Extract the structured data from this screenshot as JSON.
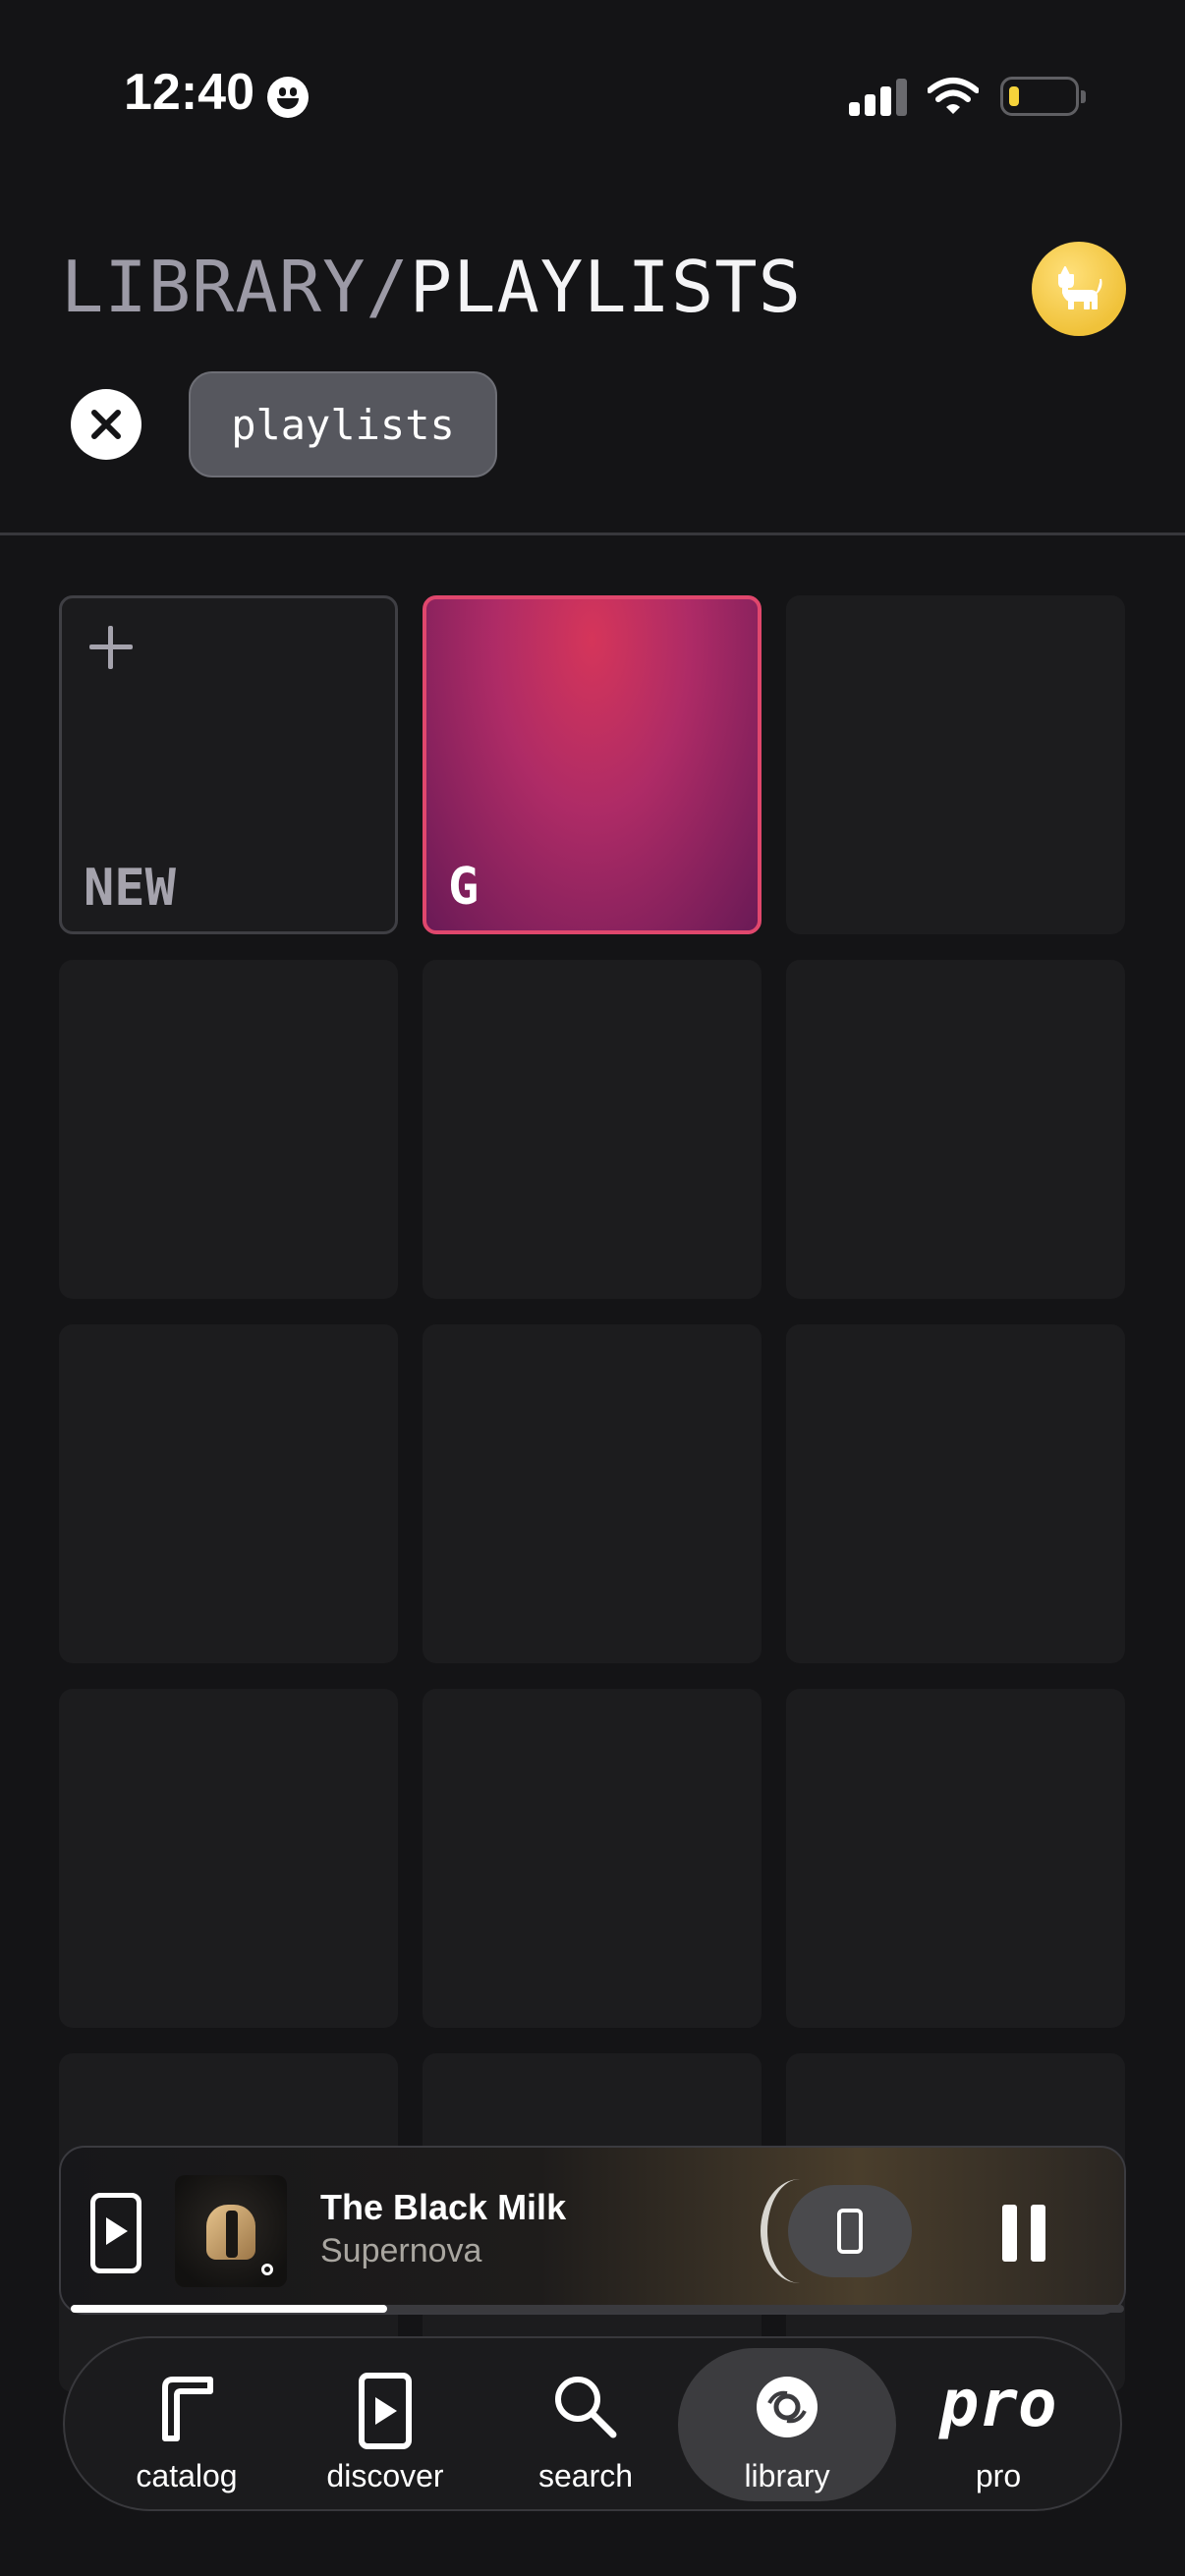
{
  "status_bar": {
    "time": "12:40",
    "emoji_icon": "grinning-face-icon",
    "battery_color": "#f5d33b"
  },
  "header": {
    "breadcrumb_root": "LIBRARY/",
    "breadcrumb_current": "PLAYLISTS",
    "avatar_icon": "cat-icon",
    "avatar_color": "#f0c23a"
  },
  "filters": {
    "close_icon": "close-icon",
    "active_chip": "playlists"
  },
  "grid": {
    "new_tile_label": "NEW",
    "playlists": [
      {
        "label": "G",
        "accent": "#e0476d"
      }
    ],
    "empty_slots": 13
  },
  "now_playing": {
    "title": "The Black Milk",
    "artist": "Supernova",
    "progress": 0.3,
    "device_icon": "phone-icon",
    "pause_icon": "pause-icon"
  },
  "tabs": [
    {
      "label": "catalog",
      "icon": "catalog-icon"
    },
    {
      "label": "discover",
      "icon": "discover-icon"
    },
    {
      "label": "search",
      "icon": "search-icon"
    },
    {
      "label": "library",
      "icon": "vinyl-icon",
      "active": true
    },
    {
      "label": "pro",
      "glyph": "pro"
    }
  ]
}
